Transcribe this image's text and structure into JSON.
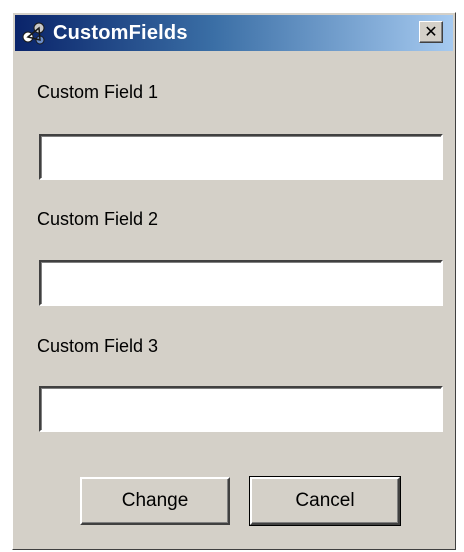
{
  "window": {
    "title": "CustomFields",
    "close_glyph": "✕",
    "icon": "app-icon"
  },
  "fields": [
    {
      "label": "Custom Field 1",
      "value": ""
    },
    {
      "label": "Custom Field 2",
      "value": ""
    },
    {
      "label": "Custom Field 3",
      "value": ""
    }
  ],
  "buttons": {
    "change_label": "Change",
    "cancel_label": "Cancel"
  },
  "colors": {
    "titlebar_start": "#0a246a",
    "titlebar_end": "#a6caf0",
    "dialog_background": "#d4d0c8"
  }
}
